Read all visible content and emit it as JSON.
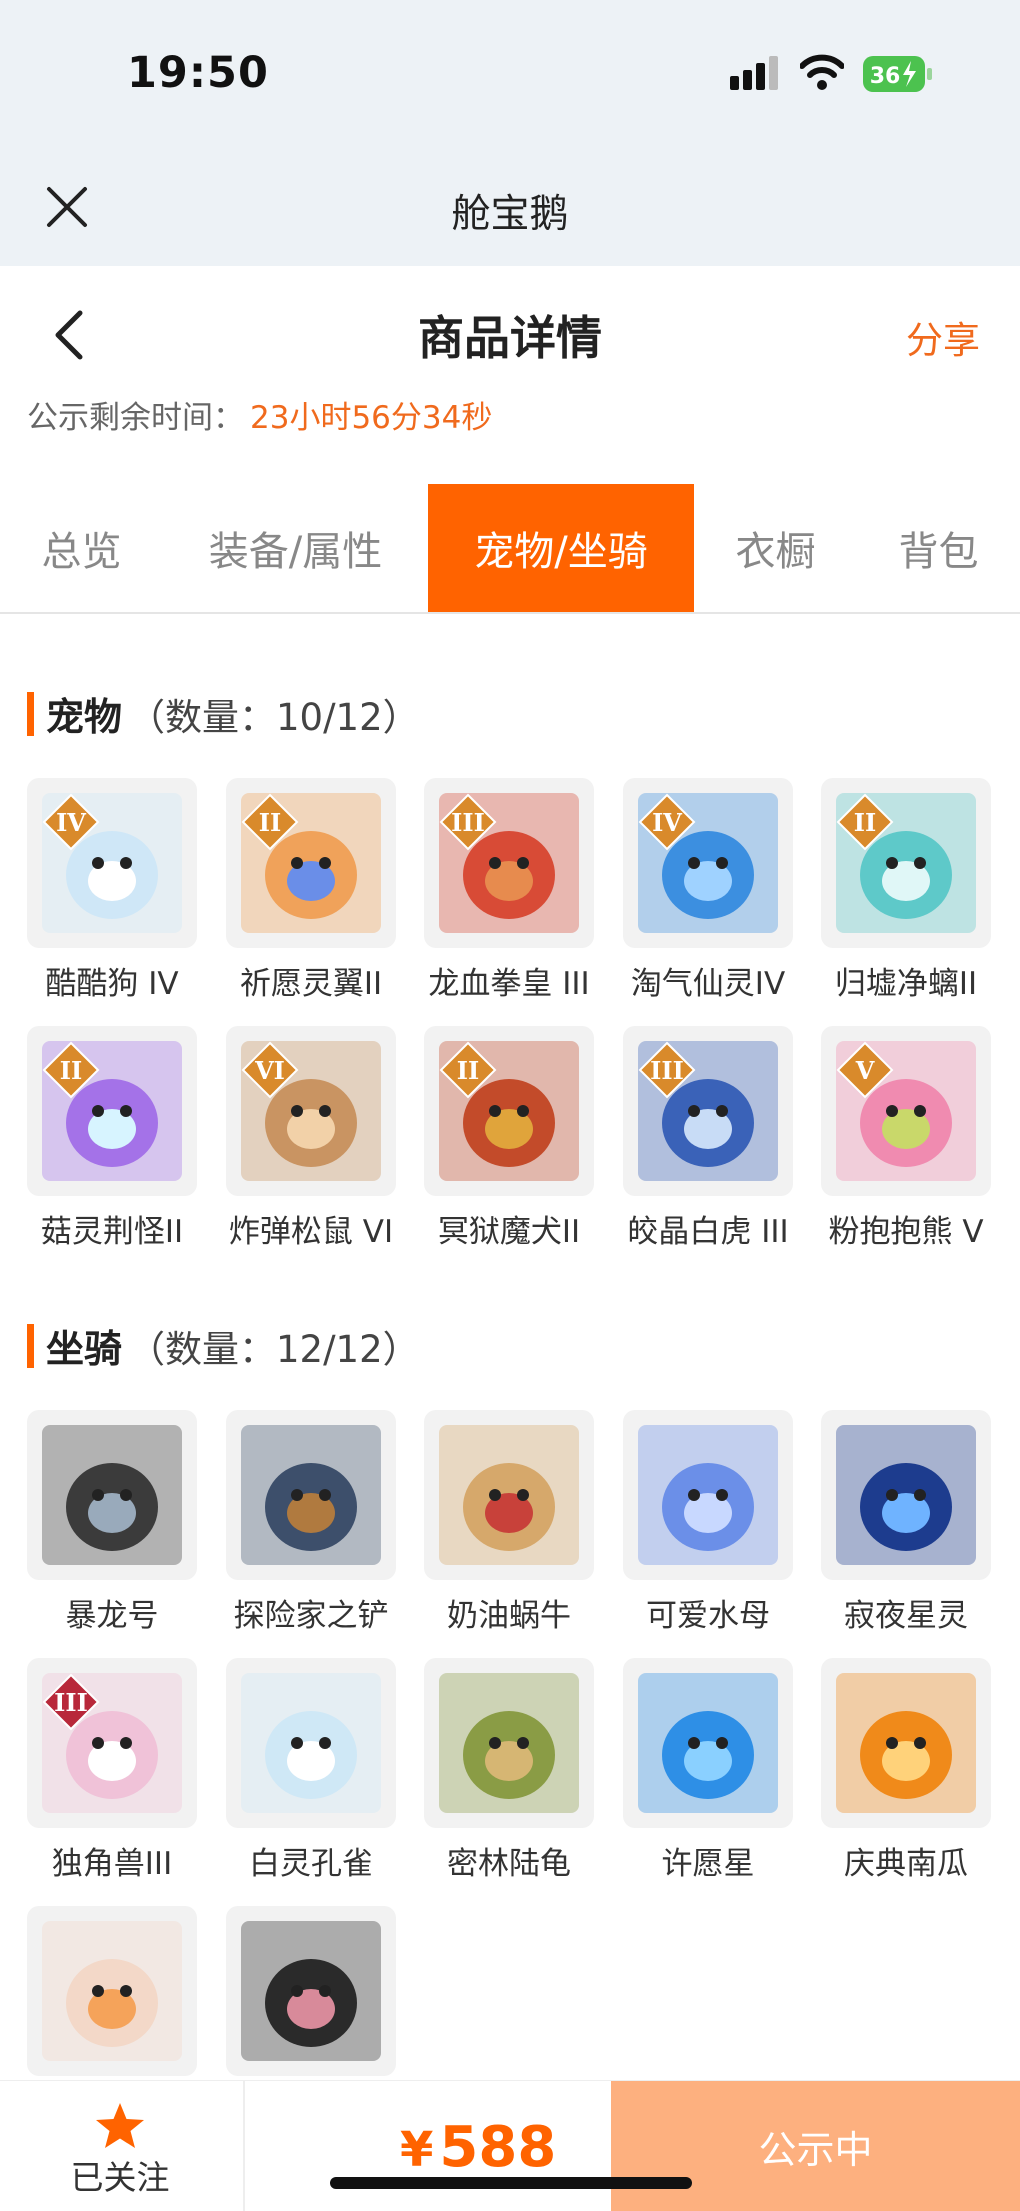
{
  "status_bar": {
    "time": "19:50",
    "battery": "36"
  },
  "app": {
    "title": "舱宝鹅"
  },
  "header": {
    "title": "商品详情",
    "share": "分享"
  },
  "countdown": {
    "label": "公示剩余时间：",
    "value": "23小时56分34秒"
  },
  "tabs": [
    "总览",
    "装备/属性",
    "宠物/坐骑",
    "衣橱",
    "背包"
  ],
  "active_tab": "宠物/坐骑",
  "pets": {
    "title": "宠物",
    "count": "（数量：10/12）",
    "items": [
      {
        "name": "酷酷狗 IV",
        "badge": "IV",
        "color": "#cfe7f7",
        "accent": "#ffffff"
      },
      {
        "name": "祈愿灵翼II",
        "badge": "II",
        "color": "#f0a25a",
        "accent": "#6a8ee8"
      },
      {
        "name": "龙血拳皇 III",
        "badge": "III",
        "color": "#d84b36",
        "accent": "#e78b4e"
      },
      {
        "name": "淘气仙灵IV",
        "badge": "IV",
        "color": "#3c8fe0",
        "accent": "#9fd2ff"
      },
      {
        "name": "归墟净螭II",
        "badge": "II",
        "color": "#5ec9c9",
        "accent": "#e0f7f7"
      },
      {
        "name": "菇灵荆怪II",
        "badge": "II",
        "color": "#a472e8",
        "accent": "#d7f4ff"
      },
      {
        "name": "炸弹松鼠 VI",
        "badge": "VI",
        "color": "#c99462",
        "accent": "#f2d1a8"
      },
      {
        "name": "冥狱魔犬II",
        "badge": "II",
        "color": "#c34b2a",
        "accent": "#e0a43b"
      },
      {
        "name": "皎晶白虎 III",
        "badge": "III",
        "color": "#3a62b8",
        "accent": "#c8dcf6"
      },
      {
        "name": "粉抱抱熊 V",
        "badge": "V",
        "color": "#f08bb0",
        "accent": "#c9d86a"
      }
    ]
  },
  "mounts": {
    "title": "坐骑",
    "count": "（数量：12/12）",
    "items": [
      {
        "name": "暴龙号",
        "badge": "",
        "color": "#3b3b3b",
        "accent": "#9ab"
      },
      {
        "name": "探险家之铲",
        "badge": "",
        "color": "#3d4f6b",
        "accent": "#b07a3f"
      },
      {
        "name": "奶油蜗牛",
        "badge": "",
        "color": "#d6a86b",
        "accent": "#c8413a"
      },
      {
        "name": "可爱水母",
        "badge": "",
        "color": "#6b8fe8",
        "accent": "#c8d8ff"
      },
      {
        "name": "寂夜星灵",
        "badge": "",
        "color": "#1d3c8e",
        "accent": "#6fb3ff"
      },
      {
        "name": "独角兽III",
        "badge": "III",
        "color": "#f0c2d8",
        "accent": "#ffffff"
      },
      {
        "name": "白灵孔雀",
        "badge": "",
        "color": "#cfe8f6",
        "accent": "#ffffff"
      },
      {
        "name": "密林陆龟",
        "badge": "",
        "color": "#8a9c45",
        "accent": "#d6b673"
      },
      {
        "name": "许愿星",
        "badge": "",
        "color": "#2e8fe6",
        "accent": "#8ad0ff"
      },
      {
        "name": "庆典南瓜",
        "badge": "",
        "color": "#f08a1a",
        "accent": "#ffd27a"
      },
      {
        "name": "",
        "badge": "",
        "color": "#f3d8c8",
        "accent": "#f5a35a"
      },
      {
        "name": "",
        "badge": "",
        "color": "#2a2a2a",
        "accent": "#d88a9a"
      }
    ]
  },
  "bottom": {
    "follow": "已关注",
    "currency": "¥",
    "price": "588",
    "status": "公示中"
  },
  "colors": {
    "accent": "#ff6300",
    "status_button": "#fdb07f"
  }
}
